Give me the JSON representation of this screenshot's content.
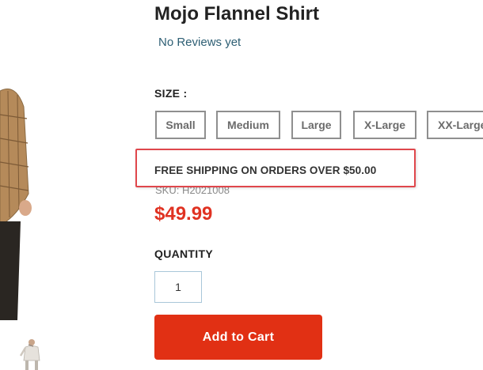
{
  "product": {
    "title": "Mojo Flannel Shirt",
    "reviews_text": "No Reviews yet",
    "size_label": "SIZE :",
    "size_options": [
      "Small",
      "Medium",
      "Large",
      "X-Large",
      "XX-Large"
    ],
    "shipping_notice": "FREE SHIPPING ON ORDERS OVER $50.00",
    "sku_text": "SKU: H2021008",
    "price": "$49.99",
    "quantity_label": "QUANTITY",
    "quantity_value": "1",
    "add_to_cart_label": "Add to Cart"
  },
  "icons": {
    "main_image": "product-photo-shirt",
    "thumbnail": "product-thumbnail-model"
  },
  "colors": {
    "accent_red": "#e13014",
    "price_red": "#e03222",
    "review_link": "#2e5f74",
    "highlight_border": "#e0474c"
  }
}
